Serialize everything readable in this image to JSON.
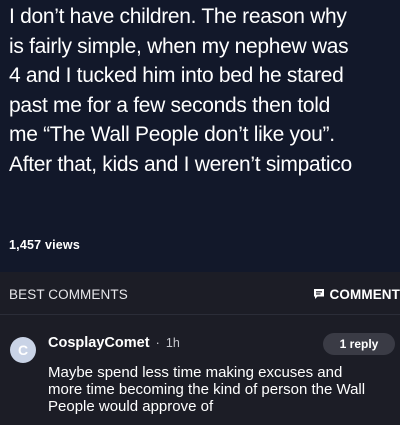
{
  "post": {
    "lines": [
      "I don’t have children. The reason why",
      "is fairly simple, when my nephew was",
      "4 and I tucked him into bed he stared",
      "past me for a few seconds then told",
      "me “The Wall People don’t like you”.",
      "After that, kids and I weren’t simpatico"
    ],
    "views": "1,457 views"
  },
  "comments": {
    "header": "BEST COMMENTS",
    "button_label": "COMMENT",
    "button_icon": "comment-icon",
    "items": [
      {
        "avatar_letter": "C",
        "username": "CosplayComet",
        "separator": "·",
        "time": "1h",
        "replies": "1 reply",
        "lines": [
          "Maybe spend less time making excuses and",
          "more time becoming the kind of person the Wall",
          "People would approve of"
        ]
      }
    ]
  },
  "colors": {
    "post_background": "#12182a",
    "comments_background": "#1c1d26",
    "text": "#ffffff",
    "avatar": "#c9d3e6",
    "reply_pill": "#3a3b45"
  }
}
